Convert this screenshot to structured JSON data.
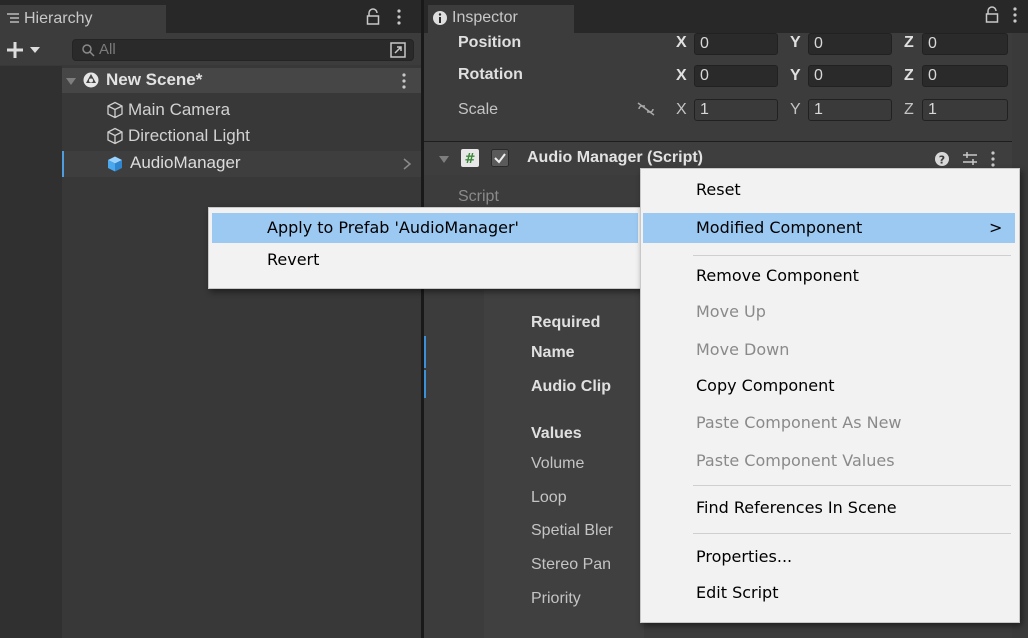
{
  "hierarchy": {
    "tab_label": "Hierarchy",
    "search_placeholder": "All",
    "scene_name": "New Scene*",
    "items": [
      {
        "label": "Main Camera",
        "icon": "gameobject-icon"
      },
      {
        "label": "Directional Light",
        "icon": "gameobject-icon"
      },
      {
        "label": "AudioManager",
        "icon": "prefab-icon",
        "selected": true
      }
    ]
  },
  "inspector": {
    "tab_label": "Inspector",
    "transform": {
      "position": {
        "label": "Position",
        "x": "0",
        "y": "0",
        "z": "0"
      },
      "rotation": {
        "label": "Rotation",
        "x": "0",
        "y": "0",
        "z": "0"
      },
      "scale": {
        "label": "Scale",
        "x": "1",
        "y": "1",
        "z": "1"
      },
      "axis_x": "X",
      "axis_y": "Y",
      "axis_z": "Z"
    },
    "component_title": "Audio Manager (Script)",
    "fields": {
      "script": "Script",
      "required": "Required",
      "name": "Name",
      "audio_clip": "Audio Clip",
      "values": "Values",
      "volume": "Volume",
      "loop": "Loop",
      "spatial_blend": "Spetial Bler",
      "stereo_pan": "Stereo Pan",
      "priority": "Priority"
    }
  },
  "prefab_menu": {
    "items": [
      "Apply to Prefab 'AudioManager'",
      "Revert"
    ]
  },
  "context_menu": {
    "items": [
      {
        "label": "Reset",
        "enabled": true
      },
      {
        "label": "Modified Component",
        "enabled": true,
        "submenu": true,
        "submenu_arrow": ">"
      },
      {
        "label": "Remove Component",
        "enabled": true
      },
      {
        "label": "Move Up",
        "enabled": false
      },
      {
        "label": "Move Down",
        "enabled": false
      },
      {
        "label": "Copy Component",
        "enabled": true
      },
      {
        "label": "Paste Component As New",
        "enabled": false
      },
      {
        "label": "Paste Component Values",
        "enabled": false
      },
      {
        "label": "Find References In Scene",
        "enabled": true
      },
      {
        "label": "Properties...",
        "enabled": true
      },
      {
        "label": "Edit Script",
        "enabled": true
      }
    ]
  },
  "colors": {
    "selection_blue": "#4f9ddd",
    "menu_highlight": "#9bc9f2"
  }
}
